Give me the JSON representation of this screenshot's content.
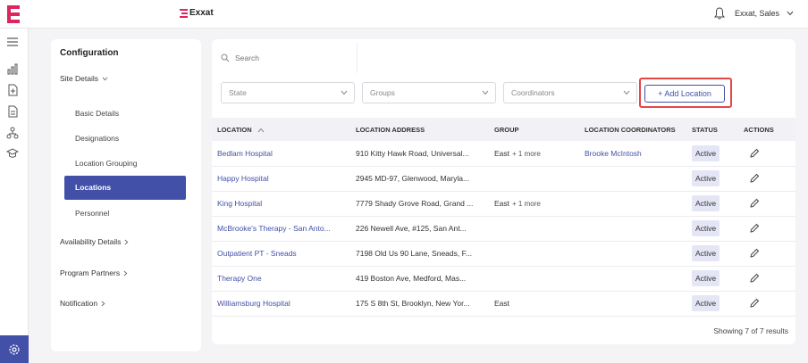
{
  "header": {
    "brand": "Exxat",
    "user_label": "Exxat, Sales"
  },
  "colors": {
    "primary": "#4350a8",
    "brand_red": "#e0245e",
    "highlight_border": "#e64545",
    "status_bg": "#e4e6f6"
  },
  "rail": {
    "icons": [
      "menu-icon",
      "analytics-icon",
      "add-document-icon",
      "document-icon",
      "network-icon",
      "graduation-icon"
    ],
    "bottom_icon": "gear-icon"
  },
  "config": {
    "title": "Configuration",
    "groups": [
      {
        "label": "Site Details",
        "expanded": true,
        "items": [
          "Basic Details",
          "Designations",
          "Location Grouping",
          "Locations",
          "Personnel"
        ],
        "active": "Locations"
      },
      {
        "label": "Availability Details",
        "expanded": false
      },
      {
        "label": "Program Partners",
        "expanded": false
      },
      {
        "label": "Notification",
        "expanded": false
      }
    ]
  },
  "search": {
    "placeholder": "Search"
  },
  "filters": {
    "state": "State",
    "groups": "Groups",
    "coordinators": "Coordinators"
  },
  "add_button": "+ Add Location",
  "table": {
    "columns": [
      "LOCATION",
      "LOCATION ADDRESS",
      "GROUP",
      "LOCATION COORDINATORS",
      "STATUS",
      "ACTIONS"
    ],
    "rows": [
      {
        "location": "Bedlam Hospital",
        "address": "910 Kitty Hawk Road, Universal...",
        "group": "East",
        "more": "+ 1 more",
        "coordinators": "Brooke McIntosh",
        "status": "Active"
      },
      {
        "location": "Happy Hospital",
        "address": "2945 MD-97, Glenwood, Maryla...",
        "group": "",
        "more": "",
        "coordinators": "",
        "status": "Active"
      },
      {
        "location": "King Hospital",
        "address": "7779 Shady Grove Road, Grand ...",
        "group": "East",
        "more": "+ 1 more",
        "coordinators": "",
        "status": "Active"
      },
      {
        "location": "McBrooke's Therapy - San Anto...",
        "address": "226 Newell Ave, #125, San Ant...",
        "group": "",
        "more": "",
        "coordinators": "",
        "status": "Active"
      },
      {
        "location": "Outpatient PT - Sneads",
        "address": "7198 Old Us 90 Lane, Sneads, F...",
        "group": "",
        "more": "",
        "coordinators": "",
        "status": "Active"
      },
      {
        "location": "Therapy One",
        "address": "419 Boston Ave, Medford, Mas...",
        "group": "",
        "more": "",
        "coordinators": "",
        "status": "Active"
      },
      {
        "location": "Williamsburg Hospital",
        "address": "175 S 8th St, Brooklyn, New Yor...",
        "group": "East",
        "more": "",
        "coordinators": "",
        "status": "Active"
      }
    ],
    "footer": "Showing 7 of 7 results"
  }
}
